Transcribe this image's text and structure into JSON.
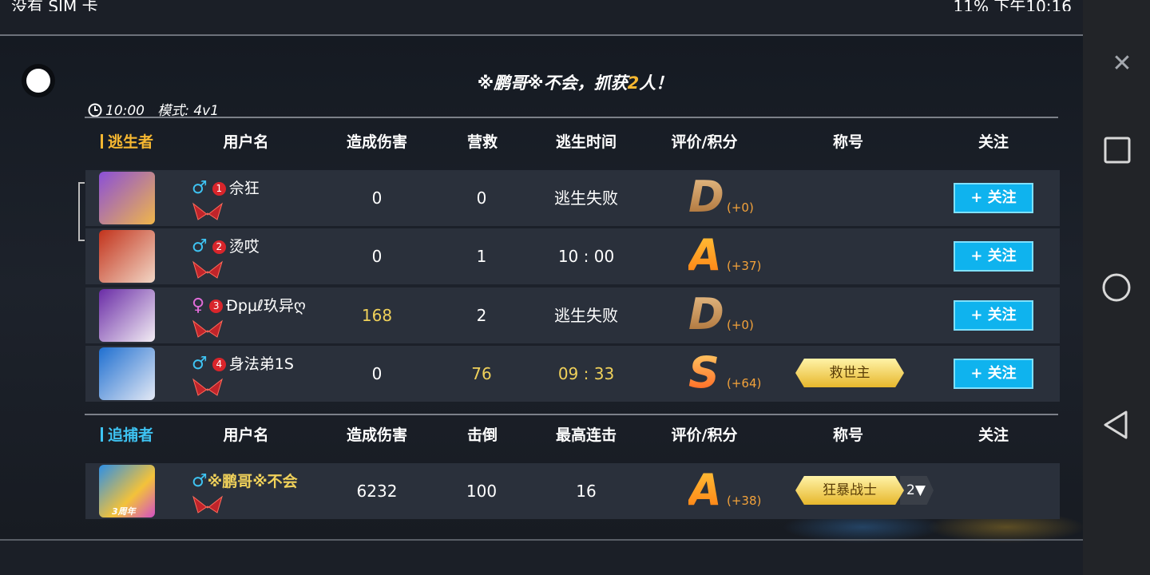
{
  "status_bar": {
    "left": "没有 SIM 卡",
    "right": "11% 下午10:16"
  },
  "headline": {
    "prefix": "※鹏哥※不会，抓获",
    "num": "2",
    "suffix": "人！"
  },
  "meta": {
    "time": "10:00",
    "mode": "模式: 4v1"
  },
  "escape_header": {
    "role": "逃生者",
    "username": "用户名",
    "damage": "造成伤害",
    "rescue": "营救",
    "escape_time": "逃生时间",
    "grade": "评价/积分",
    "title": "称号",
    "follow": "关注"
  },
  "escapers": [
    {
      "gender": "♂",
      "gender_type": "male",
      "rank": "1",
      "name": "佘狂",
      "damage": "0",
      "rescue": "0",
      "escape_time": "逃生失败",
      "grade": "D",
      "points": "(+0)",
      "title": "",
      "follow": "+ 关注"
    },
    {
      "gender": "♂",
      "gender_type": "male",
      "rank": "2",
      "name": "烫哎",
      "damage": "0",
      "rescue": "1",
      "escape_time": "10 : 00",
      "grade": "A",
      "points": "(+37)",
      "title": "",
      "follow": "+ 关注"
    },
    {
      "gender": "♀",
      "gender_type": "female",
      "rank": "3",
      "name": "Ɖpμℓ玖异ღ",
      "damage": "168",
      "rescue": "2",
      "escape_time": "逃生失败",
      "grade": "D",
      "points": "(+0)",
      "title": "",
      "follow": "+ 关注"
    },
    {
      "gender": "♂",
      "gender_type": "male",
      "rank": "4",
      "name": "身法弟1S",
      "damage": "0",
      "rescue": "76",
      "escape_time": "09 : 33",
      "grade": "S",
      "points": "(+64)",
      "title": "救世主",
      "follow": "+ 关注"
    }
  ],
  "chaser_header": {
    "role": "追捕者",
    "username": "用户名",
    "damage": "造成伤害",
    "knockdown": "击倒",
    "combo": "最高连击",
    "grade": "评价/积分",
    "title": "称号",
    "follow": "关注"
  },
  "chaser": {
    "gender": "♂",
    "name": "※鹏哥※不会",
    "damage": "6232",
    "knockdown": "100",
    "combo": "16",
    "grade": "A",
    "points": "(+38)",
    "title": "狂暴战士",
    "title_count": "2▼",
    "avatar_caption": "3周年"
  },
  "icons": [
    "close-icon",
    "square-nav-icon",
    "circle-nav-icon",
    "back-nav-icon",
    "clock-icon",
    "rank-crest-icon"
  ],
  "colors": {
    "accent_yellow": "#f5b731",
    "accent_blue": "#3ec3f2",
    "follow_button": "#0fb3ee"
  }
}
